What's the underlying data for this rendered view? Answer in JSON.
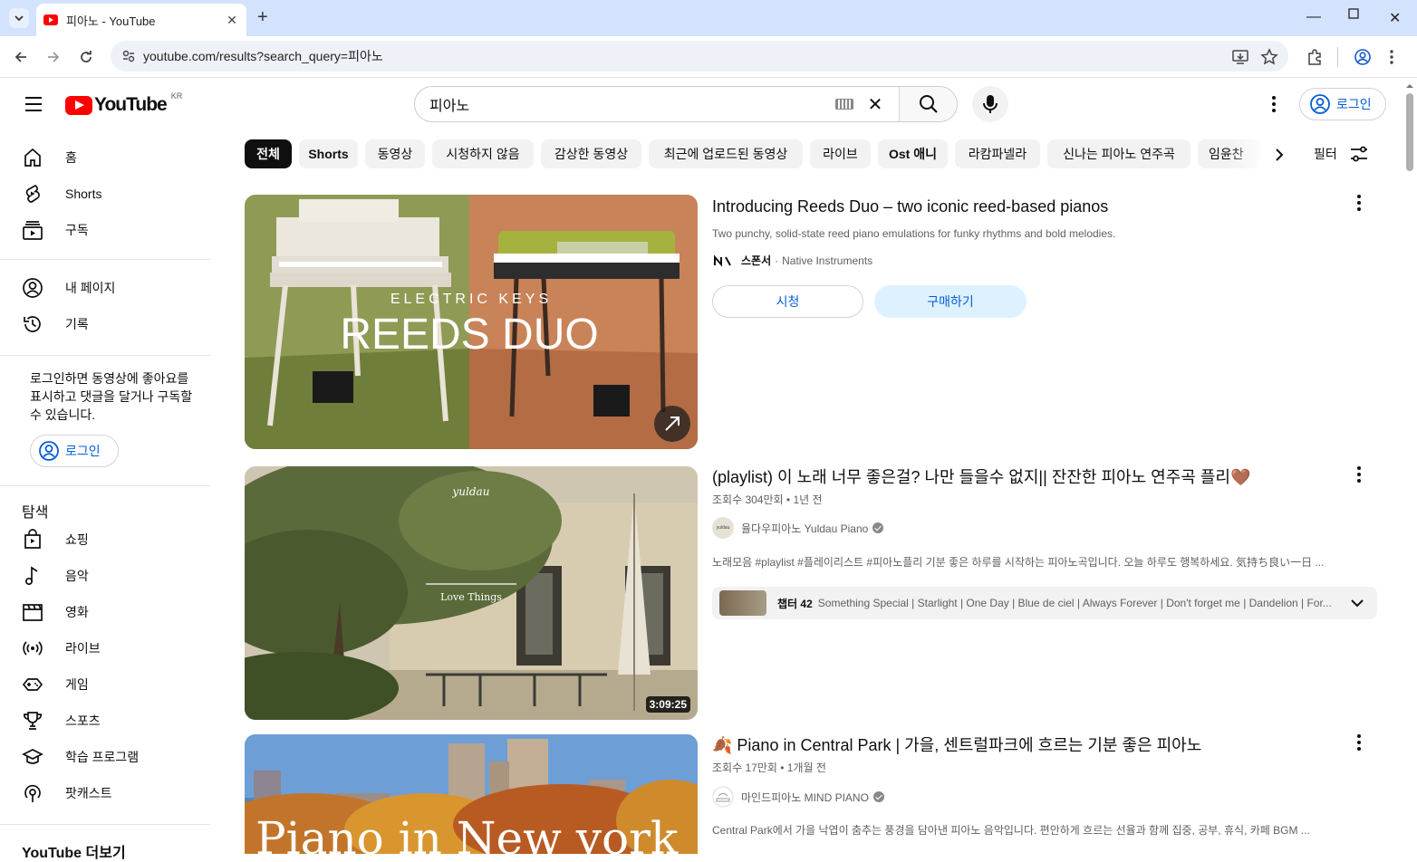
{
  "browser": {
    "tab_title": "피아노 - YouTube",
    "url": "youtube.com/results?search_query=피아노"
  },
  "header": {
    "logo_text": "YouTube",
    "region": "KR",
    "search_value": "피아노",
    "login_label": "로그인"
  },
  "sidebar": {
    "items": [
      {
        "label": "홈",
        "icon": "home-icon"
      },
      {
        "label": "Shorts",
        "icon": "shorts-icon"
      },
      {
        "label": "구독",
        "icon": "subscriptions-icon"
      },
      {
        "label": "내 페이지",
        "icon": "account-icon"
      },
      {
        "label": "기록",
        "icon": "history-icon"
      }
    ],
    "login_message": "로그인하면 동영상에 좋아요를 표시하고 댓글을 달거나 구독할 수 있습니다.",
    "login_label": "로그인",
    "explore_heading": "탐색",
    "explore": [
      {
        "label": "쇼핑",
        "icon": "shopping-icon"
      },
      {
        "label": "음악",
        "icon": "music-icon"
      },
      {
        "label": "영화",
        "icon": "movie-icon"
      },
      {
        "label": "라이브",
        "icon": "live-icon"
      },
      {
        "label": "게임",
        "icon": "gaming-icon"
      },
      {
        "label": "스포츠",
        "icon": "sports-icon"
      },
      {
        "label": "학습 프로그램",
        "icon": "learning-icon"
      },
      {
        "label": "팟캐스트",
        "icon": "podcast-icon"
      }
    ],
    "more_heading": "YouTube 더보기"
  },
  "chips": [
    "전체",
    "Shorts",
    "동영상",
    "시청하지 않음",
    "감상한 동영상",
    "최근에 업로드된 동영상",
    "라이브",
    "Ost 애니",
    "라캄파넬라",
    "신나는 피아노 연주곡",
    "임윤찬"
  ],
  "filter_label": "필터",
  "results": {
    "ad": {
      "title": "Introducing Reeds Duo – two iconic reed-based pianos",
      "description": "Two punchy, solid-state reed piano emulations for funky rhythms and bold melodies.",
      "sponsor_label": "스폰서",
      "sponsor_name": "Native Instruments",
      "thumb_small_text": "ELECTRIC KEYS",
      "thumb_big_text": "REEDS DUO",
      "watch_label": "시청",
      "buy_label": "구매하기"
    },
    "video1": {
      "title": "(playlist) 이 노래 너무 좋은걸? 나만 들을수 없지|| 잔잔한 피아노 연주곡 플리🤎",
      "views": "조회수 304만회",
      "age": "1년 전",
      "channel": "율다우피아노 Yuldau Piano",
      "avatar_text": "yuldau",
      "description": "노래모음 #playlist #플레이리스트 #피아노플리 기분 좋은 하루를 시작하는 피아노곡입니다. 오늘 하루도 행복하세요. 気持ち良い一日 ...",
      "duration": "3:09:25",
      "thumb_brand": "yuldau",
      "thumb_caption": "Love Things",
      "chapters_label": "챕터 42",
      "chapters_text": "Something Special | Starlight | One Day | Blue de ciel | Always Forever | Don't forget me | Dandelion | For..."
    },
    "video2": {
      "title": "🍂 Piano in Central Park | 가을, 센트럴파크에 흐르는 기분 좋은 피아노",
      "views": "조회수 17만회",
      "age": "1개월 전",
      "channel": "마인드피아노 MIND PIANO",
      "description": "Central Park에서 가을 낙엽이 춤추는 풍경을 담아낸 피아노 음악입니다. 편안하게 흐르는 선율과 함께 집중, 공부, 휴식, 카페 BGM ...",
      "thumb_text": "Piano in New york"
    }
  }
}
